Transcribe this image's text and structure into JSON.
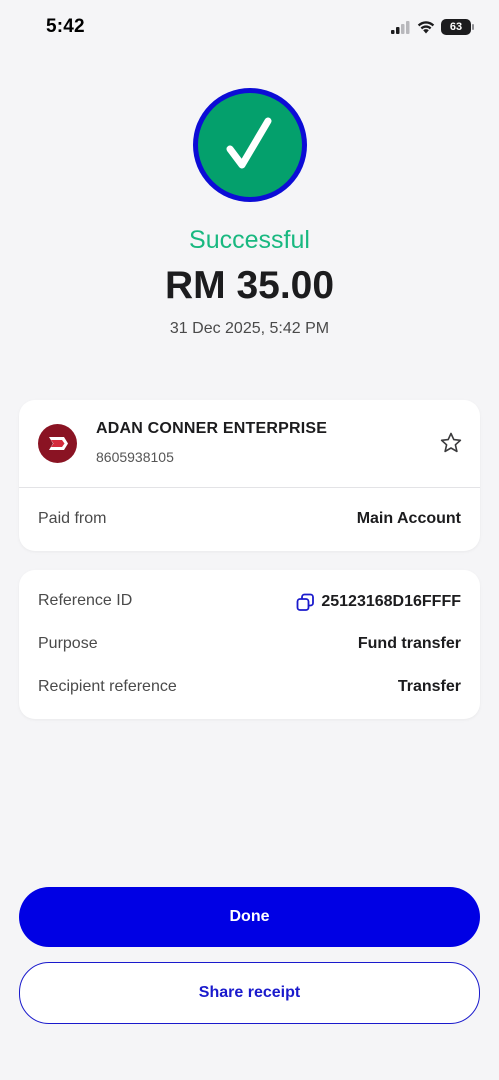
{
  "status_bar": {
    "time": "5:42",
    "battery_level": "63",
    "icons": [
      "cellular-signal-icon",
      "wifi-icon",
      "battery-icon"
    ]
  },
  "receipt": {
    "status": "Successful",
    "amount": "RM 35.00",
    "datetime": "31 Dec 2025, 5:42 PM",
    "status_icon": "checkmark-icon"
  },
  "recipient": {
    "name": "ADAN CONNER ENTERPRISE",
    "account": "8605938105",
    "logo_icon": "bank-logo-icon",
    "favorite_icon": "star-icon",
    "paid_from_label": "Paid from",
    "paid_from_value": "Main Account"
  },
  "details": {
    "reference_id_label": "Reference ID",
    "reference_id_value": "25123168D16FFFF",
    "copy_icon": "copy-icon",
    "purpose_label": "Purpose",
    "purpose_value": "Fund transfer",
    "recipient_reference_label": "Recipient reference",
    "recipient_reference_value": "Transfer"
  },
  "actions": {
    "done_label": "Done",
    "share_label": "Share receipt"
  },
  "colors": {
    "success_green": "#04a06c",
    "success_text": "#19b880",
    "primary_blue": "#0000e4",
    "background": "#f5f5f7"
  }
}
